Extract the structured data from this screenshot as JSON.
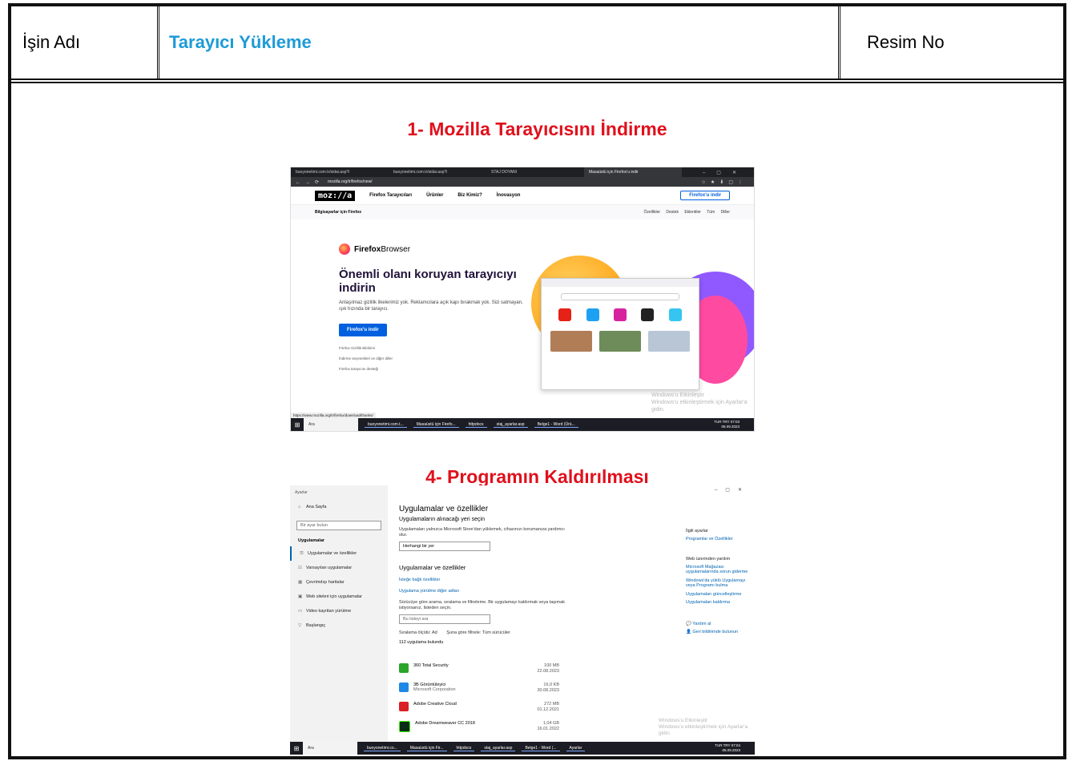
{
  "header": {
    "label_job": "İşin Adı",
    "job_name": "Tarayıcı Yükleme",
    "label_image_no": "Resim No"
  },
  "sections": [
    {
      "title": "1- Mozilla Tarayıcısını İndirme"
    },
    {
      "title": "4- Programın Kaldırılması"
    }
  ],
  "firefox_shot": {
    "tabs": [
      "buoyonetimi.com.tr/sidai.asp?i",
      "buoyonetimi.com.tr/sidai.asp?i",
      "STAJ DOYANI",
      "Masaüstü için Firefox'u indir"
    ],
    "url": "mozilla.org/tr/firefox/new/",
    "logo": "moz://a",
    "nav": [
      "Firefox Tarayıcıları",
      "Ürünler",
      "Biz Kimiz?",
      "İnovasyon"
    ],
    "top_download": "Firefox'u indir",
    "subnav_left": "Bilgisayarlar için Firefox",
    "subnav_right": "Özellikler  Destek  Eklentiler  Tüm Diller",
    "brand_bold": "Firefox",
    "brand_light": " Browser",
    "headline": "Önemli olanı koruyan tarayıcıyı indirin",
    "description": "Anlaşılmaz gizlilik ilkelerimiz yok. Reklamcılara açık kapı bırakmak yok. Sizi satmayan, ışık hızında bir tarayıcı.",
    "download_button": "Firefox'u indir",
    "links": [
      "Firefox Gizlilik Bildirimi",
      "İndirme seçenekleri ve diğer diller",
      "Firefox tarayıcısı desteği"
    ],
    "watermark_title": "Windows'u Etkinleştir",
    "watermark_sub": "Windows'u etkinleştirmek için Ayarlar'a gidin.",
    "status_url": "https://www.mozilla.org/tr/firefox/download/thanks/",
    "taskbar": {
      "search": "Ara",
      "items": [
        "buoyonetimi.com.t...",
        "Masaüstü için Firefo...",
        "httpdocs",
        "staj_ayarlar.asp",
        "Belge1 - Word (Ürü..."
      ],
      "time": "07:03",
      "date": "05.09.2023",
      "lang": "TUR TRY"
    }
  },
  "settings_shot": {
    "window_title": "Ayarlar",
    "nav_home": "Ana Sayfa",
    "search_placeholder": "Bir ayar bulun",
    "section": "Uygulamalar",
    "nav_items": [
      "Uygulamalar ve özellikler",
      "Varsayılan uygulamalar",
      "Çevrimdışı haritalar",
      "Web siteleri için uygulamalar",
      "Video kayıttan yürütme",
      "Başlangıç"
    ],
    "page_title": "Uygulamalar ve özellikler",
    "choose_where": "Uygulamaların alınacağı yeri seçin",
    "choose_desc": "Uygulamaları yalnızca Microsoft Store'dan yüklemek, cihazınızı korumanıza yardımcı olur.",
    "dropdown_value": "Herhangi bir yer",
    "apps_heading": "Uygulamalar ve özellikler",
    "optional_features": "İsteğe bağlı özellikler",
    "aliases": "Uygulama yürütme diğer adları",
    "filter_desc": "Sürücüye göre arama, sıralama ve filtreleme. Bir uygulamayı kaldırmak veya taşımak istiyorsanız, listeden seçin.",
    "list_search_placeholder": "Bu listeyi ara",
    "sort_label": "Sıralama ölçütü: Ad",
    "filter_label": "Şuna göre filtrele: Tüm sürücüler",
    "found": "112 uygulama bulundu",
    "apps": [
      {
        "name": "360 Total Security",
        "publisher": "",
        "size": "100 MB",
        "date": "22.08.2023",
        "color": "#2aa52a"
      },
      {
        "name": "3B Görüntüleyici",
        "publisher": "Microsoft Corporation",
        "size": "16,0 KB",
        "date": "30.08.2023",
        "color": "#1e88e5"
      },
      {
        "name": "Adobe Creative Cloud",
        "publisher": "",
        "size": "272 MB",
        "date": "01.12.2021",
        "color": "#da1f26"
      },
      {
        "name": "Adobe Dreamweaver CC 2018",
        "publisher": "",
        "size": "1,04 GB",
        "date": "16.01.2022",
        "color": "#35fa00"
      }
    ],
    "related_heading": "İlgili ayarlar",
    "related_link": "Programlar ve Özellikler",
    "web_help": "Web üzerinden yardım",
    "help_links": [
      "Microsoft Mağazası uygulamalarında sorun giderme",
      "Windows'da yüklü Uygulamayı veya Programı bulma",
      "Uygulamaları güncelleştirme",
      "Uygulamaları kaldırma"
    ],
    "get_help": "Yardım al",
    "feedback": "Geri bildirimde bulunun",
    "watermark_title": "Windows'u Etkinleştir",
    "watermark_sub": "Windows'u etkinleştirmek için Ayarlar'a gidin.",
    "taskbar": {
      "search": "Ara",
      "items": [
        "buoyonetimi.co...",
        "Masaüstü için Fir...",
        "httpdocs",
        "staj_ayarlar.asp",
        "Belge1 - Word (...",
        "Ayarlar"
      ],
      "time": "07:04",
      "date": "05.09.2023",
      "lang": "TUR TRY"
    }
  }
}
